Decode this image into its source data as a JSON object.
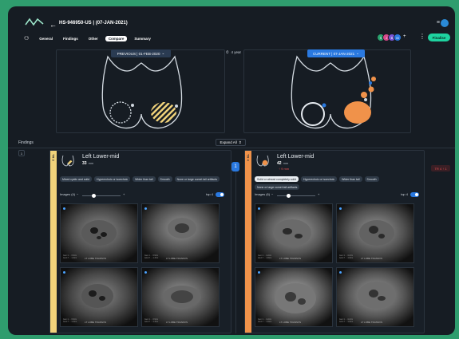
{
  "header": {
    "title": "HS-946950-US | (07-JAN-2021)",
    "back_icon": "arrow-left-icon",
    "menu_icon": "menu-icon",
    "tabs": [
      {
        "label": "General",
        "active": false
      },
      {
        "label": "Findings",
        "active": false
      },
      {
        "label": "Other",
        "active": false
      },
      {
        "label": "Compare",
        "active": true
      },
      {
        "label": "Summary",
        "active": false
      }
    ],
    "avatars": [
      {
        "initials": "S",
        "color": "#2aa36e"
      },
      {
        "initials": "J",
        "color": "#d64a8a"
      },
      {
        "initials": "B",
        "color": "#7a55d6"
      },
      {
        "initials": "M",
        "color": "#2a79e0"
      }
    ],
    "avatar_more": "+",
    "finalise_label": "Finalise"
  },
  "compare": {
    "previous_label": "PREVIOUS | 01-FEB-2020",
    "current_label": "CURRENT | 07-JAN-2021",
    "interval_label": "4 year",
    "chevron": "⌄"
  },
  "findings": {
    "title": "Findings",
    "expand_label": "Expand All",
    "row_number": "1",
    "previous": {
      "stripe_text": "TR 3",
      "name": "Left Lower-mid",
      "size": "33",
      "unit": "mm",
      "growth": "",
      "features": [
        {
          "label": "Mixed cystic and solid",
          "highlight": false
        },
        {
          "label": "Hyperechoic or isoechoic",
          "highlight": false
        },
        {
          "label": "Wider than tall",
          "highlight": false
        },
        {
          "label": "Smooth",
          "highlight": false
        },
        {
          "label": "None or large comet tail artifacts",
          "highlight": false
        }
      ],
      "images_label": "Images (4)",
      "top_label": "top 4",
      "images": [
        {
          "caption": "LT LOBE TRANSVS",
          "meta": "Gen 1 ... 3.9cm\nGA 17 ... 1.3cm"
        },
        {
          "caption": "LT LOBE TRANSVS",
          "meta": "Gen 1 ... 3.9cm\nGA 17 ... 1.3cm"
        },
        {
          "caption": "LT LOBE TRANSVS",
          "meta": "Gen 1 ... 3.9cm\nGA 17 ... 1.3cm"
        },
        {
          "caption": "LT LOBE TRANSVS",
          "meta": "Gen 1 ... 3.9cm\nGA 17 ... 1.3cm"
        }
      ]
    },
    "current": {
      "stripe_text": "TR 4",
      "name": "Left Lower-mid",
      "size": "42",
      "unit": "mm",
      "growth": "↑ 9 mm",
      "features": [
        {
          "label": "Solid or almost completely solid",
          "highlight": true
        },
        {
          "label": "Hyperechoic or isoechoic",
          "highlight": false
        },
        {
          "label": "Wider than tall",
          "highlight": false
        },
        {
          "label": "Smooth",
          "highlight": false
        },
        {
          "label": "None or large comet tail artifacts",
          "highlight": false
        }
      ],
      "images_label": "Images (6)",
      "top_label": "top 4",
      "images": [
        {
          "caption": "LT LOBE TRANSVS",
          "meta": "Gen 1 ... 4.2cm\nGA 17 ... 1.6cm"
        },
        {
          "caption": "LT LOBE TRANSVS",
          "meta": "Gen 1 ... 4.2cm\nGA 17 ... 1.6cm"
        },
        {
          "caption": "LT LOBE TRANSVS",
          "meta": "Gen 1 ... 4.2cm\nGA 17 ... 1.6cm"
        },
        {
          "caption": "LT LOBE TRANSVS",
          "meta": "Gen 1 ... 4.2cm\nGA 17 ... 1.6cm"
        }
      ]
    },
    "pin_label": "1",
    "badge": "TR 4 ↑ 1"
  }
}
